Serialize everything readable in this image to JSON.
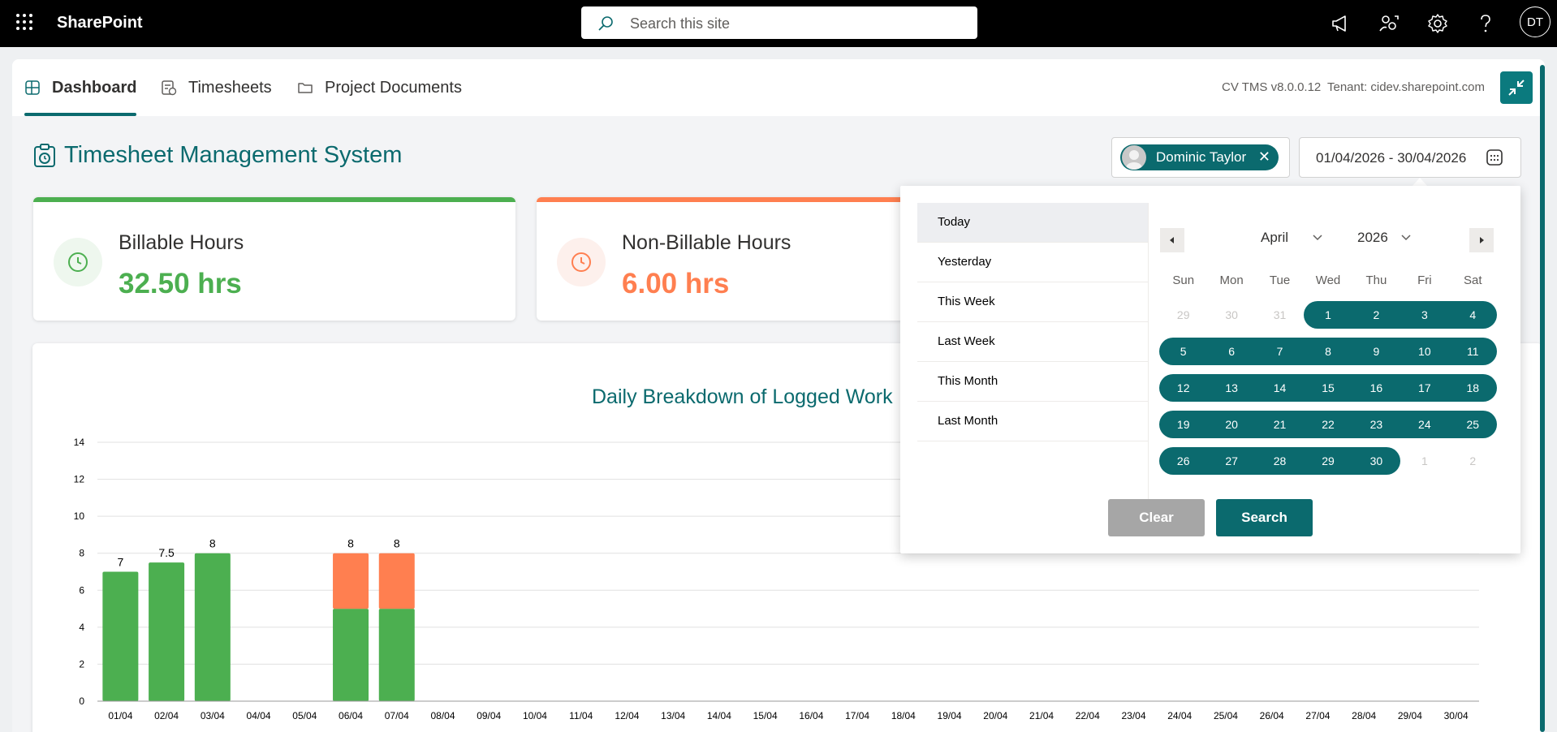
{
  "topbar": {
    "brand": "SharePoint",
    "search_placeholder": "Search this site",
    "avatar_initials": "DT"
  },
  "tabs": [
    {
      "label": "Dashboard",
      "icon": "dashboard-icon",
      "active": true
    },
    {
      "label": "Timesheets",
      "icon": "timesheet-icon",
      "active": false
    },
    {
      "label": "Project Documents",
      "icon": "folder-icon",
      "active": false
    }
  ],
  "header_meta": {
    "version": "CV TMS v8.0.0.12",
    "tenant": "Tenant: cidev.sharepoint.com"
  },
  "page": {
    "title": "Timesheet Management System"
  },
  "filters": {
    "person": "Dominic Taylor",
    "date_range": "01/04/2026 - 30/04/2026"
  },
  "cards": [
    {
      "label": "Billable Hours",
      "value": "32.50 hrs",
      "color": "#4caf50",
      "bg": "#eef7ee"
    },
    {
      "label": "Non-Billable Hours",
      "value": "6.00 hrs",
      "color": "#ff7f50",
      "bg": "#fdf0ec"
    }
  ],
  "chart_data": {
    "type": "bar",
    "title": "Daily Breakdown of Logged Work",
    "stacked": true,
    "categories": [
      "01/04",
      "02/04",
      "03/04",
      "04/04",
      "05/04",
      "06/04",
      "07/04",
      "08/04",
      "09/04",
      "10/04",
      "11/04",
      "12/04",
      "13/04",
      "14/04",
      "15/04",
      "16/04",
      "17/04",
      "18/04",
      "19/04",
      "20/04",
      "21/04",
      "22/04",
      "23/04",
      "24/04",
      "25/04",
      "26/04",
      "27/04",
      "28/04",
      "29/04",
      "30/04"
    ],
    "series": [
      {
        "color": "#4caf50",
        "values": [
          7,
          7.5,
          8,
          0,
          0,
          5,
          5,
          0,
          0,
          0,
          0,
          0,
          0,
          0,
          0,
          0,
          0,
          0,
          0,
          0,
          0,
          0,
          0,
          0,
          0,
          0,
          0,
          0,
          0,
          0
        ]
      },
      {
        "color": "#ff7f50",
        "values": [
          0,
          0,
          0,
          0,
          0,
          3,
          3,
          0,
          0,
          0,
          0,
          0,
          0,
          0,
          0,
          0,
          0,
          0,
          0,
          0,
          0,
          0,
          0,
          0,
          0,
          0,
          0,
          0,
          0,
          0
        ]
      }
    ],
    "totals_labels": [
      "7",
      "7.5",
      "8",
      "",
      "",
      "8",
      "8"
    ],
    "ylim": [
      0,
      14
    ],
    "yticks": [
      0,
      2,
      4,
      6,
      8,
      10,
      12,
      14
    ],
    "grid": true
  },
  "date_picker": {
    "presets": [
      "Today",
      "Yesterday",
      "This Week",
      "Last Week",
      "This Month",
      "Last Month"
    ],
    "selected_preset": "Today",
    "month": "April",
    "year": "2026",
    "weekdays": [
      "Sun",
      "Mon",
      "Tue",
      "Wed",
      "Thu",
      "Fri",
      "Sat"
    ],
    "weeks": [
      [
        {
          "d": "29",
          "in": false
        },
        {
          "d": "30",
          "in": false
        },
        {
          "d": "31",
          "in": false
        },
        {
          "d": "1",
          "in": true
        },
        {
          "d": "2",
          "in": true
        },
        {
          "d": "3",
          "in": true
        },
        {
          "d": "4",
          "in": true
        }
      ],
      [
        {
          "d": "5",
          "in": true
        },
        {
          "d": "6",
          "in": true
        },
        {
          "d": "7",
          "in": true
        },
        {
          "d": "8",
          "in": true
        },
        {
          "d": "9",
          "in": true
        },
        {
          "d": "10",
          "in": true
        },
        {
          "d": "11",
          "in": true
        }
      ],
      [
        {
          "d": "12",
          "in": true
        },
        {
          "d": "13",
          "in": true
        },
        {
          "d": "14",
          "in": true
        },
        {
          "d": "15",
          "in": true
        },
        {
          "d": "16",
          "in": true
        },
        {
          "d": "17",
          "in": true
        },
        {
          "d": "18",
          "in": true
        }
      ],
      [
        {
          "d": "19",
          "in": true
        },
        {
          "d": "20",
          "in": true
        },
        {
          "d": "21",
          "in": true
        },
        {
          "d": "22",
          "in": true
        },
        {
          "d": "23",
          "in": true
        },
        {
          "d": "24",
          "in": true
        },
        {
          "d": "25",
          "in": true
        }
      ],
      [
        {
          "d": "26",
          "in": true
        },
        {
          "d": "27",
          "in": true
        },
        {
          "d": "28",
          "in": true
        },
        {
          "d": "29",
          "in": true
        },
        {
          "d": "30",
          "in": true
        },
        {
          "d": "1",
          "in": false
        },
        {
          "d": "2",
          "in": false
        }
      ]
    ],
    "clear_label": "Clear",
    "search_label": "Search"
  }
}
